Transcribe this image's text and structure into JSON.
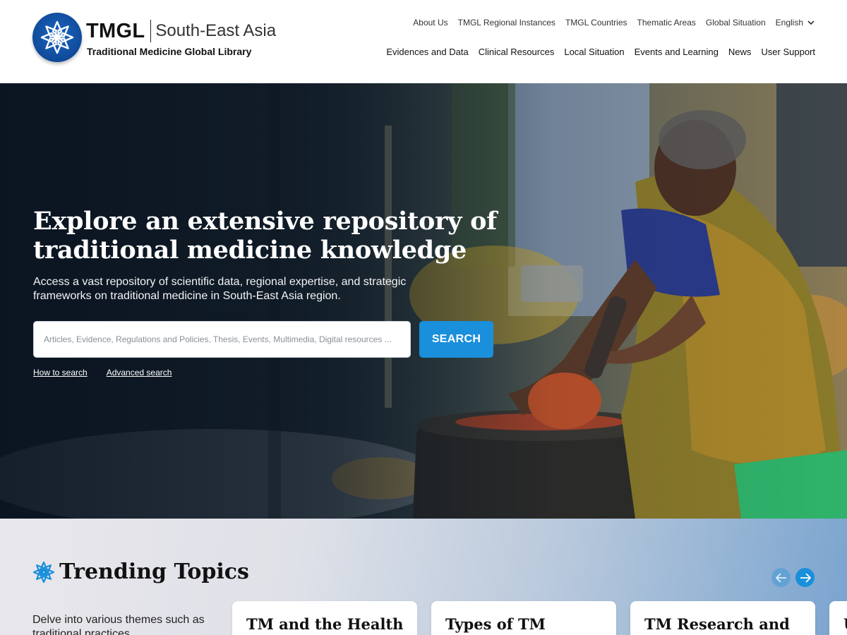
{
  "header": {
    "brand_name": "TMGL",
    "brand_region": "South-East Asia",
    "brand_subtitle": "Traditional Medicine Global Library",
    "logo_icon": "star-flower-icon",
    "top_nav": [
      "About Us",
      "TMGL Regional Instances",
      "TMGL Countries",
      "Thematic Areas",
      "Global Situation"
    ],
    "language": "English",
    "main_nav": [
      "Evidences and Data",
      "Clinical Resources",
      "Local Situation",
      "Events and Learning",
      "News",
      "User Support"
    ]
  },
  "hero": {
    "title": "Explore an extensive repository of traditional medicine knowledge",
    "subtitle": "Access a vast repository of scientific data, regional expertise, and strategic frameworks on traditional medicine in South-East Asia region.",
    "search_placeholder": "Articles, Evidence, Regulations and Policies, Thesis, Events, Multimedia, Digital resources ...",
    "search_button": "SEARCH",
    "how_to_search": "How to search",
    "advanced_search": "Advanced search"
  },
  "trending": {
    "title": "Trending Topics",
    "description": "Delve into various themes such as traditional practices",
    "cards": [
      "TM and the Health",
      "Types of TM",
      "TM Research and",
      "U"
    ]
  },
  "colors": {
    "accent": "#1a8fdb",
    "logo_blue": "#0f4a9a"
  }
}
